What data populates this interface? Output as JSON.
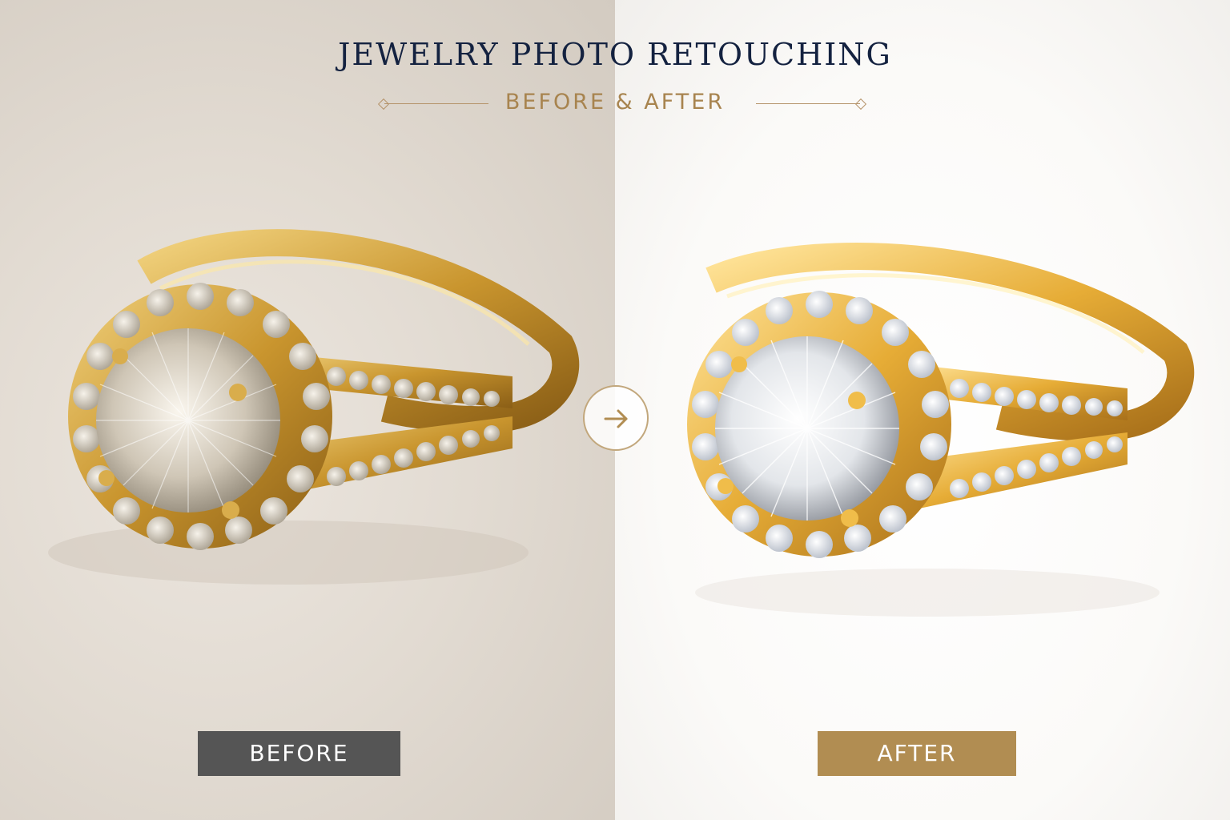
{
  "header": {
    "title": "JEWELRY PHOTO RETOUCHING",
    "subtitle": "BEFORE & AFTER"
  },
  "comparison": {
    "before_label": "BEFORE",
    "after_label": "AFTER",
    "arrow_icon": "arrow-right-icon"
  },
  "colors": {
    "title": "#142240",
    "accent_gold": "#b18d52",
    "before_label_bg": "#555555",
    "before_background": "#e2dbd2",
    "after_background": "#ffffff"
  }
}
